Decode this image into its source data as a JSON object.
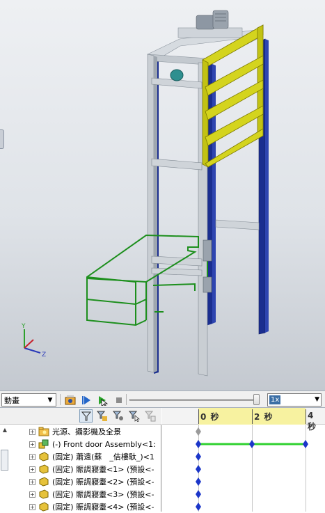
{
  "viewport": {
    "triad_axes": [
      "Y",
      "Z"
    ],
    "colors": {
      "frame": "#bfc6cc",
      "post_blue": "#1a2e8f",
      "door_yellow": "#d4d41e",
      "cage_green": "#1d8f1d"
    }
  },
  "animation_toolbar": {
    "study_type": "動畫",
    "speed": "1x",
    "buttons": [
      "calculate-icon",
      "play-from-start-icon",
      "play-icon",
      "stop-icon"
    ],
    "playback_position": 0.95
  },
  "tree": {
    "filter_icons": [
      "filter-icon",
      "filter-animated-icon",
      "filter-driving-icon",
      "filter-selected-icon",
      "filter-results-icon"
    ],
    "rows": [
      {
        "label": "光源、攝影機及全景",
        "icon": "folder-lights-icon"
      },
      {
        "label": "(-) Front door Assembly<1:",
        "icon": "assembly-icon"
      },
      {
        "label": "(固定) 蕭遠(蘇　_佶樓馱_)<1",
        "icon": "part-icon"
      },
      {
        "label": "(固定) 賑調寢耋<1> (預設<-",
        "icon": "part-icon"
      },
      {
        "label": "(固定) 賑調寢耋<2> (預設<-",
        "icon": "part-icon"
      },
      {
        "label": "(固定) 賑調寢耋<3> (預設<-",
        "icon": "part-icon"
      },
      {
        "label": "(固定) 賑調寢耋<4> (預設<-",
        "icon": "part-icon"
      }
    ]
  },
  "timeline": {
    "labels": [
      "0 秒",
      "2 秒",
      "4 秒"
    ]
  }
}
